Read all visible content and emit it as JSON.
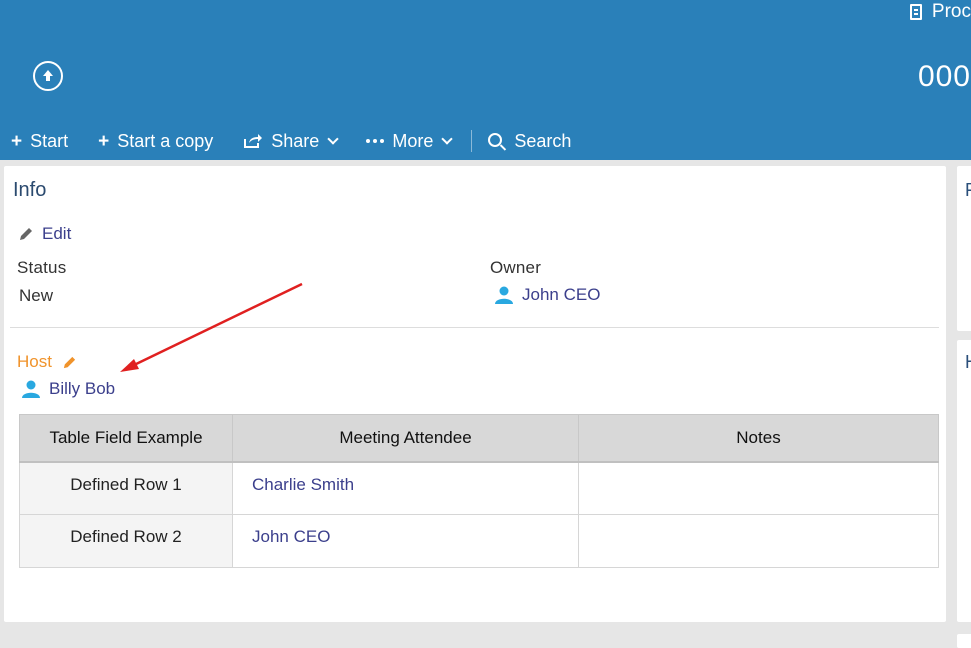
{
  "header": {
    "top_right_label": "Proc",
    "record_number": "000",
    "toolbar": {
      "start": "Start",
      "start_copy": "Start a copy",
      "share": "Share",
      "more": "More",
      "search": "Search"
    }
  },
  "info": {
    "title": "Info",
    "edit": "Edit",
    "status_label": "Status",
    "status_value": "New",
    "owner_label": "Owner",
    "owner_value": "John CEO",
    "host_label": "Host",
    "host_value": "Billy Bob"
  },
  "table": {
    "headers": [
      "Table Field Example",
      "Meeting Attendee",
      "Notes"
    ],
    "rows": [
      {
        "label": "Defined Row 1",
        "attendee": "Charlie Smith",
        "notes": ""
      },
      {
        "label": "Defined Row 2",
        "attendee": "John CEO",
        "notes": ""
      }
    ]
  },
  "side_panels": [
    "F",
    "H"
  ],
  "colors": {
    "header_bg": "#2a80b9",
    "link": "#3b3f8c",
    "host_accent": "#f0932b",
    "person_icon": "#29a8e0",
    "annotation_arrow": "#e02020"
  },
  "icons": [
    "document-icon",
    "upload-circle-icon",
    "plus-icon",
    "share-icon",
    "chevron-down-icon",
    "more-dots-icon",
    "search-icon",
    "pencil-icon",
    "user-icon"
  ]
}
